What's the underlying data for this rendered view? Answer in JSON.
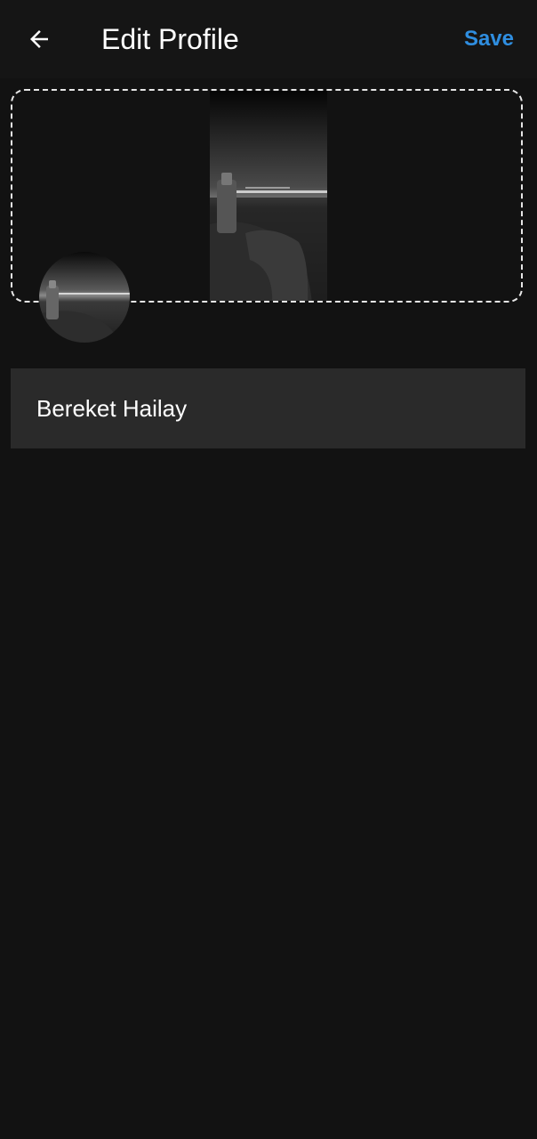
{
  "header": {
    "title": "Edit Profile",
    "save_label": "Save",
    "back_icon": "arrow-left-icon"
  },
  "cover": {
    "image_description": "black-and-white night harbor photo"
  },
  "avatar": {
    "image_description": "black-and-white night harbor photo"
  },
  "form": {
    "name_value": "Bereket Hailay"
  },
  "colors": {
    "background": "#121212",
    "header": "#151515",
    "accent": "#2f8ee0",
    "field": "#2a2a2a"
  }
}
